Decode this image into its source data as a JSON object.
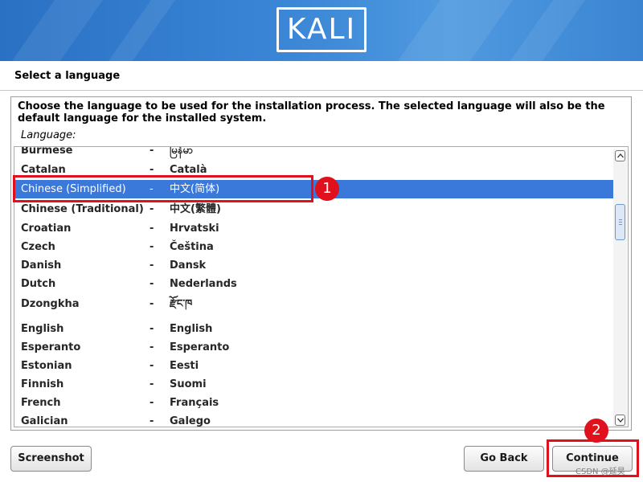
{
  "app": {
    "logo_text": "KALI"
  },
  "page": {
    "title": "Select a language",
    "description": "Choose the language to be used for the installation process. The selected language will also be the default language for the installed system.",
    "list_label": "Language:"
  },
  "languages": [
    {
      "name": "Burmese",
      "native": "မြန်မာ",
      "selected": false
    },
    {
      "name": "Catalan",
      "native": "Català",
      "selected": false
    },
    {
      "name": "Chinese (Simplified)",
      "native": "中文(简体)",
      "selected": true
    },
    {
      "name": "Chinese (Traditional)",
      "native": "中文(繁體)",
      "selected": false
    },
    {
      "name": "Croatian",
      "native": "Hrvatski",
      "selected": false
    },
    {
      "name": "Czech",
      "native": "Čeština",
      "selected": false
    },
    {
      "name": "Danish",
      "native": "Dansk",
      "selected": false
    },
    {
      "name": "Dutch",
      "native": "Nederlands",
      "selected": false
    },
    {
      "name": "Dzongkha",
      "native": "རྫོང་ཁ",
      "selected": false
    },
    {
      "name": "English",
      "native": "English",
      "selected": false
    },
    {
      "name": "Esperanto",
      "native": "Esperanto",
      "selected": false
    },
    {
      "name": "Estonian",
      "native": "Eesti",
      "selected": false
    },
    {
      "name": "Finnish",
      "native": "Suomi",
      "selected": false
    },
    {
      "name": "French",
      "native": "Français",
      "selected": false
    },
    {
      "name": "Galician",
      "native": "Galego",
      "selected": false
    }
  ],
  "separator": "-",
  "buttons": {
    "screenshot": "Screenshot",
    "go_back": "Go Back",
    "continue": "Continue"
  },
  "annotations": {
    "step1": "1",
    "step2": "2"
  },
  "watermark": "CSDN @延昊",
  "colors": {
    "selection": "#3a78d9",
    "callout": "#e0101d",
    "banner": "#3b86d6"
  }
}
